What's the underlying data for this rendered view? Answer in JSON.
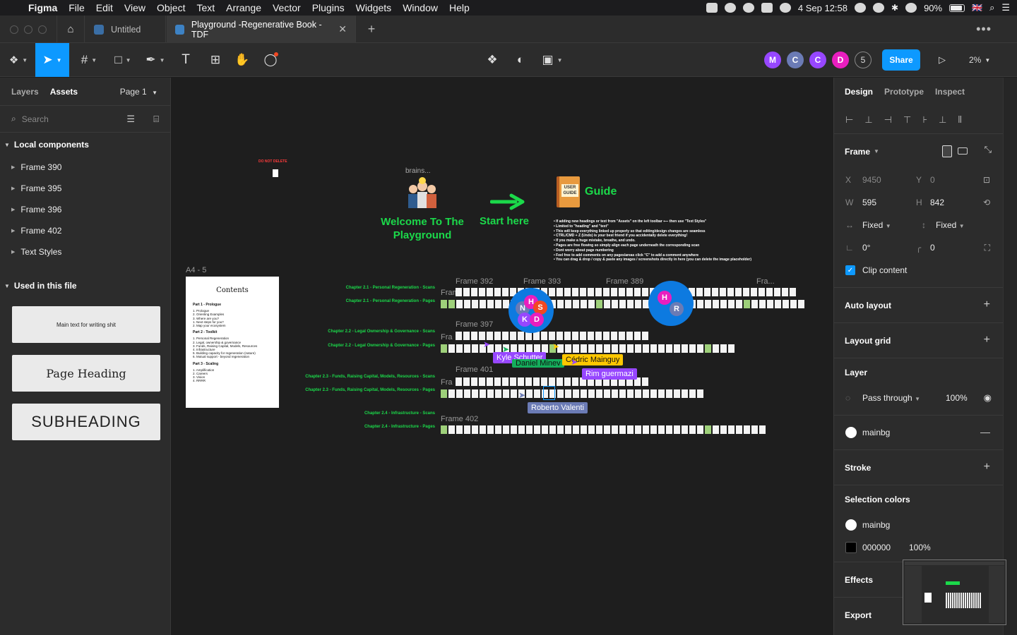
{
  "menubar": {
    "app": "Figma",
    "items": [
      "File",
      "Edit",
      "View",
      "Object",
      "Text",
      "Arrange",
      "Vector",
      "Plugins",
      "Widgets",
      "Window",
      "Help"
    ],
    "battery": "90%",
    "datetime": "4 Sep  12:58",
    "flag": "🇬🇧"
  },
  "tabs": [
    {
      "label": "Untitled"
    },
    {
      "label": "Playground -Regenerative Book - TDF"
    }
  ],
  "toolbar": {
    "avatars": [
      {
        "letter": "M",
        "color": "#9747ff"
      },
      {
        "letter": "C",
        "color": "#6b7bb5"
      },
      {
        "letter": "C",
        "color": "#9747ff"
      },
      {
        "letter": "D",
        "color": "#e91ebf"
      }
    ],
    "collab_count": "5",
    "share_label": "Share",
    "zoom": "2%"
  },
  "left": {
    "tab_layers": "Layers",
    "tab_assets": "Assets",
    "page": "Page 1",
    "search_placeholder": "Search",
    "local_components_title": "Local components",
    "components": [
      "Frame 390",
      "Frame 395",
      "Frame 396",
      "Frame 402",
      "Text Styles"
    ],
    "used_title": "Used in this file",
    "styles": {
      "main_text": "Main text for writing shit",
      "page_heading": "Page Heading",
      "subheading": "SUBHEADING"
    }
  },
  "canvas": {
    "do_not_delete": "DO NOT DELETE",
    "brains": "brains...",
    "welcome": "Welcome To The Playground",
    "start_here": "Start here",
    "guide_book": "USER GUIDE",
    "guide": "Guide",
    "guide_notes": [
      "• If adding new headings or text from \"Assets\" on the left toolbar ⟵ then use \"Text Styles\"",
      "   • Limited to \"heading\" and \"text\"",
      "   • This will keep everything linked up properly so that editing/design changes are seamless",
      "• CTRL/CMD + Z (Undo) is your best friend if you accidentally delete everything!",
      "   • If you make a huge mistake, breathe, and undo.",
      "• Pages are free flowing so simply align each page underneath the corresponding scan",
      "• Dont worry about page numbering",
      "• Feel free to add comments on any pages/areas click \"C\" to add a comment anywhere",
      "• You can drag & drop / copy & paste any images / screenshots directly in here (you can delete the image placeholder)"
    ],
    "a4_label": "A4 - 5",
    "contents": {
      "title": "Contents",
      "part1": "Part 1 - Prologue",
      "part1_items": [
        "1. Prologue",
        "2. Orienting Examples",
        "3. Where are you?",
        "   1. Next steps for you?",
        "   2. Map your ecosystem"
      ],
      "part2": "Part 2 - Toolkit",
      "part2_items": [
        "1. Personal Regeneration",
        "2. Legal, ownership & governance",
        "3. Funds, Raising Capital, Models, Resources",
        "4. Infrastructure",
        "5. Building capacity for regeneration (nature)",
        "6. Mutual support - beyond regeneration"
      ],
      "part3": "Part 3 - Scaling",
      "part3_items": [
        "1. Amplification",
        "2. Careers",
        "3. Vision",
        "4. RRRR"
      ]
    },
    "frames": {
      "f392": "Frame 392",
      "f393": "Frame 393",
      "f389": "Frame 389",
      "fra": "Fra...",
      "f397": "Frame 397",
      "f401": "Frame 401",
      "f402": "Frame 402",
      "fram_a": "Fram",
      "fram_b": "Fra",
      "fram_c": "Fra"
    },
    "chapters": {
      "c21s": "Chapter 2.1 - Personal Regeneration - Scans",
      "c21p": "Chapter 2.1 - Personal Regeneration - Pages",
      "c22s": "Chapter 2.2 - Legal Ownership & Governance - Scans",
      "c22p": "Chapter 2.2 - Legal Ownership & Governance - Pages",
      "c23s": "Chapter 2.3 - Funds, Raising Capital, Models, Resources - Scans",
      "c23p": "Chapter 2.3 - Funds, Raising Capital, Models, Resources - Pages",
      "c24s": "Chapter 2.4 - Infrastructure - Scans",
      "c24p": "Chapter 2.4 - Infrastructure - Pages"
    },
    "cursors": {
      "kyle": "Kyle Schutter",
      "daniel": "Daniel Minev",
      "cedric": "Cédric Mainguy",
      "rim": "Rim guermazi",
      "roberto": "Roberto Valenti"
    },
    "cluster1": [
      "N",
      "H",
      "S",
      "K",
      "D"
    ],
    "cluster2": [
      "H",
      "R"
    ]
  },
  "right": {
    "tab_design": "Design",
    "tab_prototype": "Prototype",
    "tab_inspect": "Inspect",
    "frame_title": "Frame",
    "x_label": "X",
    "x_val": "9450",
    "y_label": "Y",
    "y_val": "0",
    "w_label": "W",
    "w_val": "595",
    "h_label": "H",
    "h_val": "842",
    "w_mode": "Fixed",
    "h_mode": "Fixed",
    "rotation": "0°",
    "radius": "0",
    "clip_content": "Clip content",
    "auto_layout": "Auto layout",
    "layout_grid": "Layout grid",
    "layer": "Layer",
    "pass_through": "Pass through",
    "layer_opacity": "100%",
    "fill_name": "mainbg",
    "stroke": "Stroke",
    "selection_colors": "Selection colors",
    "sel1": "mainbg",
    "sel2": "000000",
    "sel2_opacity": "100%",
    "effects": "Effects",
    "export": "Export"
  }
}
